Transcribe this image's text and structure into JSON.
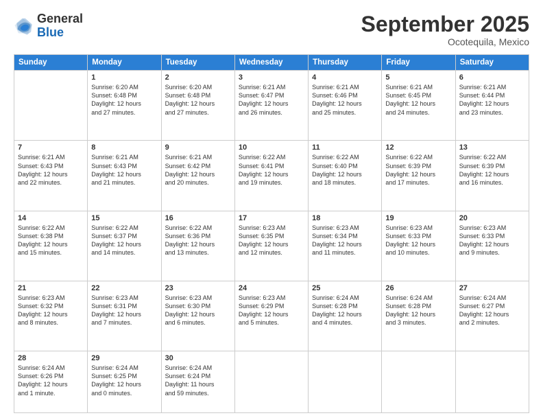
{
  "header": {
    "logo_general": "General",
    "logo_blue": "Blue",
    "month": "September 2025",
    "location": "Ocotequila, Mexico"
  },
  "days_of_week": [
    "Sunday",
    "Monday",
    "Tuesday",
    "Wednesday",
    "Thursday",
    "Friday",
    "Saturday"
  ],
  "weeks": [
    [
      {
        "day": "",
        "info": ""
      },
      {
        "day": "1",
        "info": "Sunrise: 6:20 AM\nSunset: 6:48 PM\nDaylight: 12 hours\nand 27 minutes."
      },
      {
        "day": "2",
        "info": "Sunrise: 6:20 AM\nSunset: 6:48 PM\nDaylight: 12 hours\nand 27 minutes."
      },
      {
        "day": "3",
        "info": "Sunrise: 6:21 AM\nSunset: 6:47 PM\nDaylight: 12 hours\nand 26 minutes."
      },
      {
        "day": "4",
        "info": "Sunrise: 6:21 AM\nSunset: 6:46 PM\nDaylight: 12 hours\nand 25 minutes."
      },
      {
        "day": "5",
        "info": "Sunrise: 6:21 AM\nSunset: 6:45 PM\nDaylight: 12 hours\nand 24 minutes."
      },
      {
        "day": "6",
        "info": "Sunrise: 6:21 AM\nSunset: 6:44 PM\nDaylight: 12 hours\nand 23 minutes."
      }
    ],
    [
      {
        "day": "7",
        "info": "Sunrise: 6:21 AM\nSunset: 6:43 PM\nDaylight: 12 hours\nand 22 minutes."
      },
      {
        "day": "8",
        "info": "Sunrise: 6:21 AM\nSunset: 6:43 PM\nDaylight: 12 hours\nand 21 minutes."
      },
      {
        "day": "9",
        "info": "Sunrise: 6:21 AM\nSunset: 6:42 PM\nDaylight: 12 hours\nand 20 minutes."
      },
      {
        "day": "10",
        "info": "Sunrise: 6:22 AM\nSunset: 6:41 PM\nDaylight: 12 hours\nand 19 minutes."
      },
      {
        "day": "11",
        "info": "Sunrise: 6:22 AM\nSunset: 6:40 PM\nDaylight: 12 hours\nand 18 minutes."
      },
      {
        "day": "12",
        "info": "Sunrise: 6:22 AM\nSunset: 6:39 PM\nDaylight: 12 hours\nand 17 minutes."
      },
      {
        "day": "13",
        "info": "Sunrise: 6:22 AM\nSunset: 6:39 PM\nDaylight: 12 hours\nand 16 minutes."
      }
    ],
    [
      {
        "day": "14",
        "info": "Sunrise: 6:22 AM\nSunset: 6:38 PM\nDaylight: 12 hours\nand 15 minutes."
      },
      {
        "day": "15",
        "info": "Sunrise: 6:22 AM\nSunset: 6:37 PM\nDaylight: 12 hours\nand 14 minutes."
      },
      {
        "day": "16",
        "info": "Sunrise: 6:22 AM\nSunset: 6:36 PM\nDaylight: 12 hours\nand 13 minutes."
      },
      {
        "day": "17",
        "info": "Sunrise: 6:23 AM\nSunset: 6:35 PM\nDaylight: 12 hours\nand 12 minutes."
      },
      {
        "day": "18",
        "info": "Sunrise: 6:23 AM\nSunset: 6:34 PM\nDaylight: 12 hours\nand 11 minutes."
      },
      {
        "day": "19",
        "info": "Sunrise: 6:23 AM\nSunset: 6:33 PM\nDaylight: 12 hours\nand 10 minutes."
      },
      {
        "day": "20",
        "info": "Sunrise: 6:23 AM\nSunset: 6:33 PM\nDaylight: 12 hours\nand 9 minutes."
      }
    ],
    [
      {
        "day": "21",
        "info": "Sunrise: 6:23 AM\nSunset: 6:32 PM\nDaylight: 12 hours\nand 8 minutes."
      },
      {
        "day": "22",
        "info": "Sunrise: 6:23 AM\nSunset: 6:31 PM\nDaylight: 12 hours\nand 7 minutes."
      },
      {
        "day": "23",
        "info": "Sunrise: 6:23 AM\nSunset: 6:30 PM\nDaylight: 12 hours\nand 6 minutes."
      },
      {
        "day": "24",
        "info": "Sunrise: 6:23 AM\nSunset: 6:29 PM\nDaylight: 12 hours\nand 5 minutes."
      },
      {
        "day": "25",
        "info": "Sunrise: 6:24 AM\nSunset: 6:28 PM\nDaylight: 12 hours\nand 4 minutes."
      },
      {
        "day": "26",
        "info": "Sunrise: 6:24 AM\nSunset: 6:28 PM\nDaylight: 12 hours\nand 3 minutes."
      },
      {
        "day": "27",
        "info": "Sunrise: 6:24 AM\nSunset: 6:27 PM\nDaylight: 12 hours\nand 2 minutes."
      }
    ],
    [
      {
        "day": "28",
        "info": "Sunrise: 6:24 AM\nSunset: 6:26 PM\nDaylight: 12 hours\nand 1 minute."
      },
      {
        "day": "29",
        "info": "Sunrise: 6:24 AM\nSunset: 6:25 PM\nDaylight: 12 hours\nand 0 minutes."
      },
      {
        "day": "30",
        "info": "Sunrise: 6:24 AM\nSunset: 6:24 PM\nDaylight: 11 hours\nand 59 minutes."
      },
      {
        "day": "",
        "info": ""
      },
      {
        "day": "",
        "info": ""
      },
      {
        "day": "",
        "info": ""
      },
      {
        "day": "",
        "info": ""
      }
    ]
  ]
}
